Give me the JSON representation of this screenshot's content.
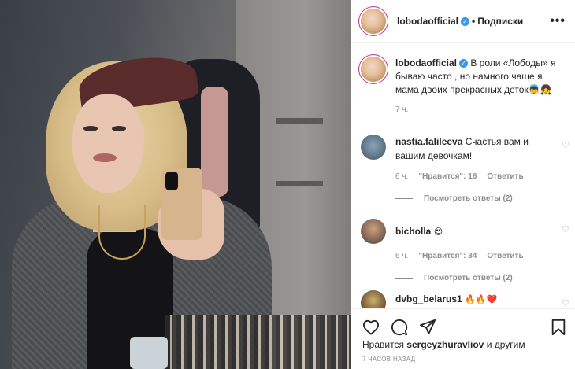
{
  "post": {
    "author": "lobodaofficial",
    "follow_label": "Подписки",
    "more_label": "•••",
    "dot": "•"
  },
  "caption": {
    "username": "lobodaofficial",
    "text": "В роли «Лободы» я бываю часто , но намного чаще я мама двоих прекрасных деток👼👧",
    "time": "7 ч."
  },
  "comments": [
    {
      "username": "nastia.falileeva",
      "text": "Счастья вам и вашим девочкам!",
      "time": "6 ч.",
      "likes": "\"Нравится\": 16",
      "reply": "Ответить",
      "view_replies": "Посмотреть ответы (2)"
    },
    {
      "username": "bicholla",
      "text": "😍",
      "time": "6 ч.",
      "likes": "\"Нравится\": 34",
      "reply": "Ответить",
      "view_replies": "Посмотреть ответы (2)"
    },
    {
      "username": "dvbg_belarus1",
      "text": "🔥🔥❤️"
    }
  ],
  "actions": {
    "likes_prefix": "Нравится",
    "liked_by": "sergeyzhuravliov",
    "likes_suffix": "и другим",
    "posted_time": "7 ЧАСОВ НАЗАД"
  },
  "icons": {
    "verified": "verified-badge-icon",
    "like": "heart-icon",
    "comment": "comment-icon",
    "share": "paper-plane-icon",
    "save": "bookmark-icon"
  },
  "colors": {
    "verified": "#3897f0",
    "muted": "#8e8e8e",
    "text": "#262626",
    "border": "#efefef"
  }
}
